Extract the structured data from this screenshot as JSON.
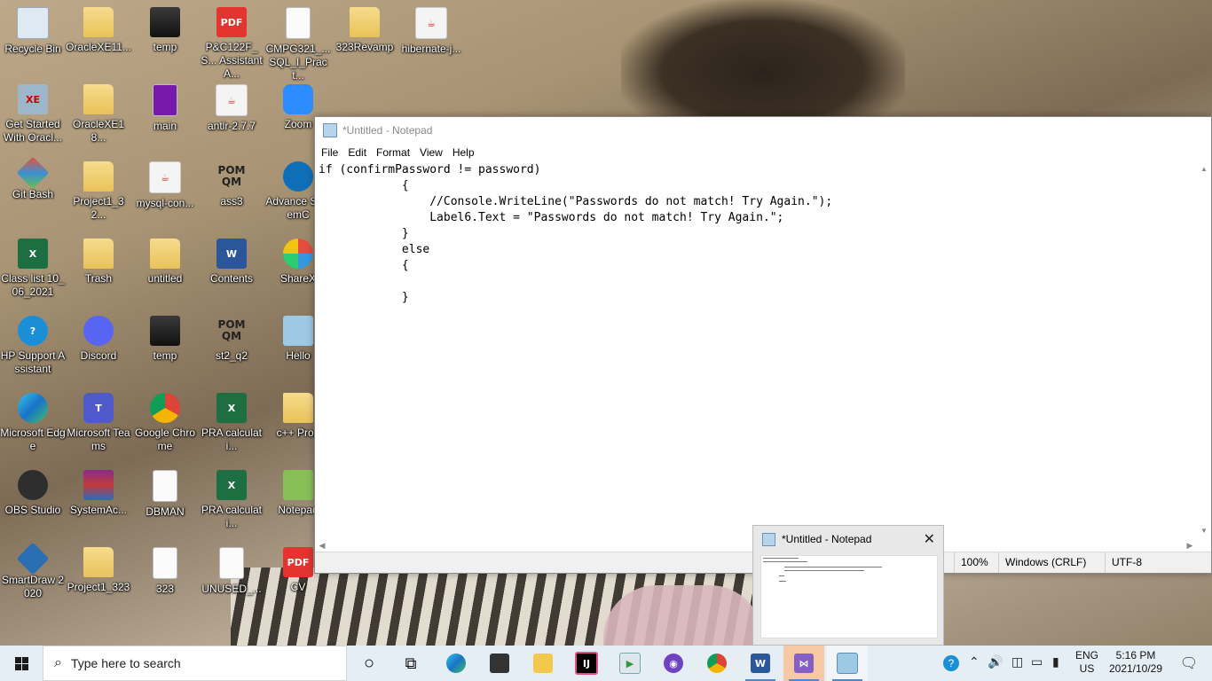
{
  "desktop": {
    "icons": [
      {
        "label": "Recycle Bin"
      },
      {
        "label": "OracleXE11..."
      },
      {
        "label": "temp"
      },
      {
        "label": "P&C122F_S... Assistant A..."
      },
      {
        "label": "CMPG321_... SQL_I_Pract..."
      },
      {
        "label": "323Revamp"
      },
      {
        "label": "hibernate-j..."
      },
      {
        "label": "Get Started With Oracl..."
      },
      {
        "label": "OracleXE18..."
      },
      {
        "label": "main"
      },
      {
        "label": "antlr-2.7.7"
      },
      {
        "label": "Zoom"
      },
      {
        "label": "Git Bash"
      },
      {
        "label": "Project1_32..."
      },
      {
        "label": "mysql-con..."
      },
      {
        "label": "ass3"
      },
      {
        "label": "Advance SystemC"
      },
      {
        "label": "Class list 10_06_2021"
      },
      {
        "label": "Trash"
      },
      {
        "label": "untitled"
      },
      {
        "label": "Contents"
      },
      {
        "label": "ShareX"
      },
      {
        "label": "HP Support Assistant"
      },
      {
        "label": "Discord"
      },
      {
        "label": "temp"
      },
      {
        "label": "st2_q2"
      },
      {
        "label": "Hello"
      },
      {
        "label": "Microsoft Edge"
      },
      {
        "label": "Microsoft Teams"
      },
      {
        "label": "Google Chrome"
      },
      {
        "label": "PRA calculati..."
      },
      {
        "label": "c++ Prog"
      },
      {
        "label": "OBS Studio"
      },
      {
        "label": "SystemAc..."
      },
      {
        "label": "DBMAN"
      },
      {
        "label": "PRA calculati..."
      },
      {
        "label": "Notepad"
      },
      {
        "label": "SmartDraw 2020"
      },
      {
        "label": "Project1_323"
      },
      {
        "label": "323"
      },
      {
        "label": "UNUSED_..."
      },
      {
        "label": "CV"
      }
    ],
    "icon_glyphs": {
      "pdf": "PDF",
      "java": "☕",
      "pom": "POM QM",
      "oracle": "XE",
      "excel": "X",
      "word": "W",
      "help": "?",
      "teams": "T"
    }
  },
  "notepad": {
    "title": "*Untitled - Notepad",
    "menu": [
      "File",
      "Edit",
      "Format",
      "View",
      "Help"
    ],
    "content": "if (confirmPassword != password)\n            {\n                //Console.WriteLine(\"Passwords do not match! Try Again.\");\n                Label6.Text = \"Passwords do not match! Try Again.\";\n            }\n            else\n            {\n\n            }",
    "status": {
      "zoom": "100%",
      "line_ending": "Windows (CRLF)",
      "encoding": "UTF-8"
    }
  },
  "thumbnail": {
    "title": "*Untitled - Notepad",
    "close_glyph": "✕"
  },
  "taskbar": {
    "search_placeholder": "Type here to search",
    "search_glyph": "⌕",
    "lang_line1": "ENG",
    "lang_line2": "US",
    "time": "5:16 PM",
    "date": "2021/10/29",
    "notification_glyph": "🗨",
    "apps": [
      "cortana",
      "task-view",
      "edge",
      "store",
      "file-explorer",
      "intellij",
      "media-player",
      "github-desktop",
      "chrome",
      "word",
      "visual-studio",
      "notepad"
    ],
    "app_glyphs": {
      "cortana": "○",
      "task-view": "⧉",
      "intellij": "IJ",
      "word": "W",
      "visual-studio": "⋈",
      "media-player": "▶",
      "github-desktop": "◉"
    },
    "tray_glyphs": {
      "help": "?",
      "chevron": "⌃",
      "volume": "🔊",
      "camera": "◫",
      "network": "▭",
      "battery": "▮"
    }
  },
  "colors": {
    "taskbar": "#e6eef5",
    "active_app": "#f6c9a4",
    "accent": "#4a8ad4"
  }
}
